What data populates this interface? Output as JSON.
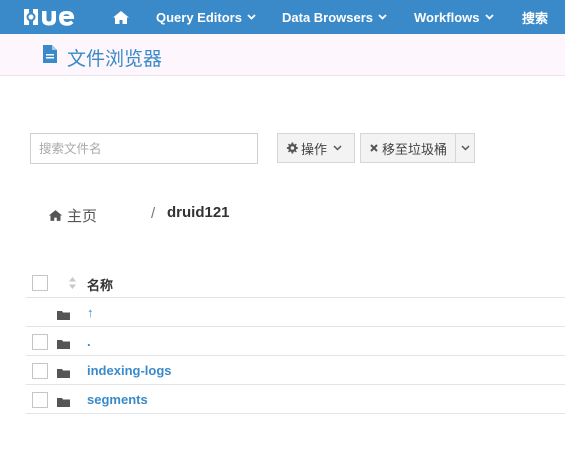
{
  "navbar": {
    "logo_text": "HUE",
    "items": [
      {
        "label": "Query Editors"
      },
      {
        "label": "Data Browsers"
      },
      {
        "label": "Workflows"
      }
    ],
    "search_label": "搜索",
    "bg_color": "#3a8ac9"
  },
  "page": {
    "title": "文件浏览器",
    "icon": "document-icon"
  },
  "toolbar": {
    "search_placeholder": "搜索文件名",
    "actions_label": "操作",
    "trash_label": "移至垃圾桶"
  },
  "breadcrumb": {
    "home_label": "主页",
    "separator": "/",
    "current": "druid121"
  },
  "table": {
    "name_header": "名称",
    "rows": [
      {
        "name": "↑",
        "type": "parent-folder",
        "has_checkbox": false
      },
      {
        "name": ".",
        "type": "folder",
        "has_checkbox": true
      },
      {
        "name": "indexing-logs",
        "type": "folder",
        "has_checkbox": true
      },
      {
        "name": "segments",
        "type": "folder",
        "has_checkbox": true
      }
    ]
  },
  "colors": {
    "accent": "#3a8ac9",
    "subheader_bg": "#fdf6fc"
  }
}
